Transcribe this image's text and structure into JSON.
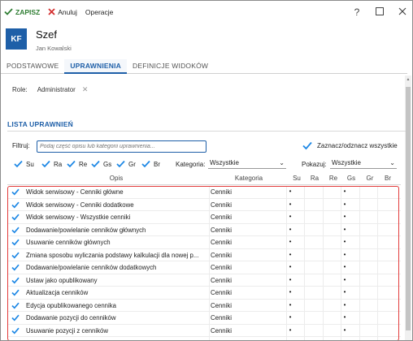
{
  "toolbar": {
    "save_label": "ZAPISZ",
    "cancel_label": "Anuluj",
    "operations_label": "Operacje",
    "colors": {
      "save": "#2e7d32",
      "cancel": "#d32f2f"
    }
  },
  "header": {
    "initials": "KF",
    "title": "Szef",
    "subtitle": "Jan Kowalski",
    "accent": "#1e5fa8"
  },
  "tabs": [
    {
      "label": "PODSTAWOWE",
      "active": false
    },
    {
      "label": "UPRAWNIENIA",
      "active": true
    },
    {
      "label": "DEFINICJE WIDOKÓW",
      "active": false
    }
  ],
  "role": {
    "label": "Role:",
    "value": "Administrator"
  },
  "section": {
    "title": "LISTA UPRAWNIEŃ"
  },
  "filter": {
    "label": "Filtruj:",
    "placeholder": "Podaj część opisu lub kategorii uprawnienia...",
    "value": "",
    "select_all_label": "Zaznacz/odznacz wszystkie",
    "select_all_checked": true
  },
  "flags": [
    {
      "label": "Su",
      "checked": true
    },
    {
      "label": "Ra",
      "checked": true
    },
    {
      "label": "Re",
      "checked": true
    },
    {
      "label": "Gs",
      "checked": true
    },
    {
      "label": "Gr",
      "checked": true
    },
    {
      "label": "Br",
      "checked": true
    }
  ],
  "category_filter": {
    "label": "Kategoria:",
    "value": "Wszystkie"
  },
  "show_filter": {
    "label": "Pokazuj:",
    "value": "Wszystkie"
  },
  "table": {
    "columns": [
      "Opis",
      "Kategoria",
      "Su",
      "Ra",
      "Re",
      "Gs",
      "Gr",
      "Br"
    ],
    "rows": [
      {
        "checked": true,
        "opis": "Widok serwisowy - Cenniki główne",
        "kategoria": "Cenniki",
        "su": "•",
        "ra": "",
        "re": "",
        "gs": "•",
        "gr": "",
        "br": ""
      },
      {
        "checked": true,
        "opis": "Widok serwisowy - Cenniki dodatkowe",
        "kategoria": "Cenniki",
        "su": "•",
        "ra": "",
        "re": "",
        "gs": "•",
        "gr": "",
        "br": ""
      },
      {
        "checked": true,
        "opis": "Widok serwisowy - Wszystkie cenniki",
        "kategoria": "Cenniki",
        "su": "•",
        "ra": "",
        "re": "",
        "gs": "•",
        "gr": "",
        "br": ""
      },
      {
        "checked": true,
        "opis": "Dodawanie/powielanie cenników głównych",
        "kategoria": "Cenniki",
        "su": "•",
        "ra": "",
        "re": "",
        "gs": "•",
        "gr": "",
        "br": ""
      },
      {
        "checked": true,
        "opis": "Usuwanie cenników głównych",
        "kategoria": "Cenniki",
        "su": "•",
        "ra": "",
        "re": "",
        "gs": "•",
        "gr": "",
        "br": ""
      },
      {
        "checked": true,
        "opis": "Zmiana sposobu wyliczania podstawy kalkulacji dla nowej p...",
        "kategoria": "Cenniki",
        "su": "•",
        "ra": "",
        "re": "",
        "gs": "•",
        "gr": "",
        "br": ""
      },
      {
        "checked": true,
        "opis": "Dodawanie/powielanie cenników dodatkowych",
        "kategoria": "Cenniki",
        "su": "•",
        "ra": "",
        "re": "",
        "gs": "•",
        "gr": "",
        "br": ""
      },
      {
        "checked": true,
        "opis": "Ustaw jako opublikowany",
        "kategoria": "Cenniki",
        "su": "•",
        "ra": "",
        "re": "",
        "gs": "•",
        "gr": "",
        "br": ""
      },
      {
        "checked": true,
        "opis": "Aktualizacja cenników",
        "kategoria": "Cenniki",
        "su": "•",
        "ra": "",
        "re": "",
        "gs": "•",
        "gr": "",
        "br": ""
      },
      {
        "checked": true,
        "opis": "Edycja opublikowanego cennika",
        "kategoria": "Cenniki",
        "su": "•",
        "ra": "",
        "re": "",
        "gs": "•",
        "gr": "",
        "br": ""
      },
      {
        "checked": true,
        "opis": "Dodawanie pozycji do cenników",
        "kategoria": "Cenniki",
        "su": "•",
        "ra": "",
        "re": "",
        "gs": "•",
        "gr": "",
        "br": ""
      },
      {
        "checked": true,
        "opis": "Usuwanie pozycji z cenników",
        "kategoria": "Cenniki",
        "su": "•",
        "ra": "",
        "re": "",
        "gs": "•",
        "gr": "",
        "br": ""
      }
    ]
  },
  "icons": {
    "save": "check-icon",
    "cancel": "close-icon",
    "help": "help-icon",
    "maximize": "maximize-icon",
    "close_window": "close-window-icon",
    "remove_role": "remove-icon",
    "checkbox": "checkbox-checked-icon"
  },
  "colors": {
    "highlight_frame": "#e23b3b",
    "checkbox": "#1e88e5"
  }
}
